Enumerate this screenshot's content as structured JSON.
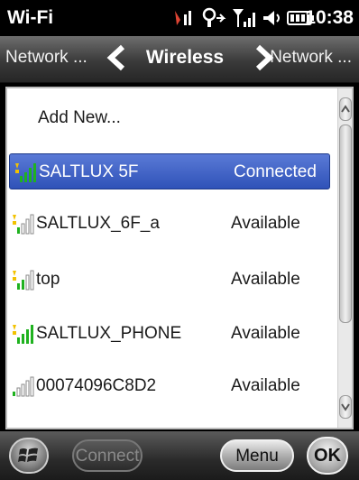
{
  "status": {
    "app_title": "Wi-Fi",
    "time": "10:38"
  },
  "nav": {
    "prev_label": "Network ...",
    "title": "Wireless",
    "next_label": "Network ..."
  },
  "list": {
    "add_new": "Add New...",
    "networks": [
      {
        "ssid": "SALTLUX 5F",
        "state": "Connected",
        "selected": true,
        "signal": "full"
      },
      {
        "ssid": "SALTLUX_6F_a",
        "state": "Available",
        "selected": false,
        "signal": "low"
      },
      {
        "ssid": "top",
        "state": "Available",
        "selected": false,
        "signal": "low"
      },
      {
        "ssid": "SALTLUX_PHONE",
        "state": "Available",
        "selected": false,
        "signal": "full"
      },
      {
        "ssid": "00074096C8D2",
        "state": "Available",
        "selected": false,
        "signal": "medium"
      }
    ]
  },
  "bottom": {
    "connect_label": "Connect",
    "menu_label": "Menu",
    "ok_label": "OK"
  },
  "colors": {
    "selection": "#2f52b8",
    "signal_green": "#1fb21f"
  }
}
